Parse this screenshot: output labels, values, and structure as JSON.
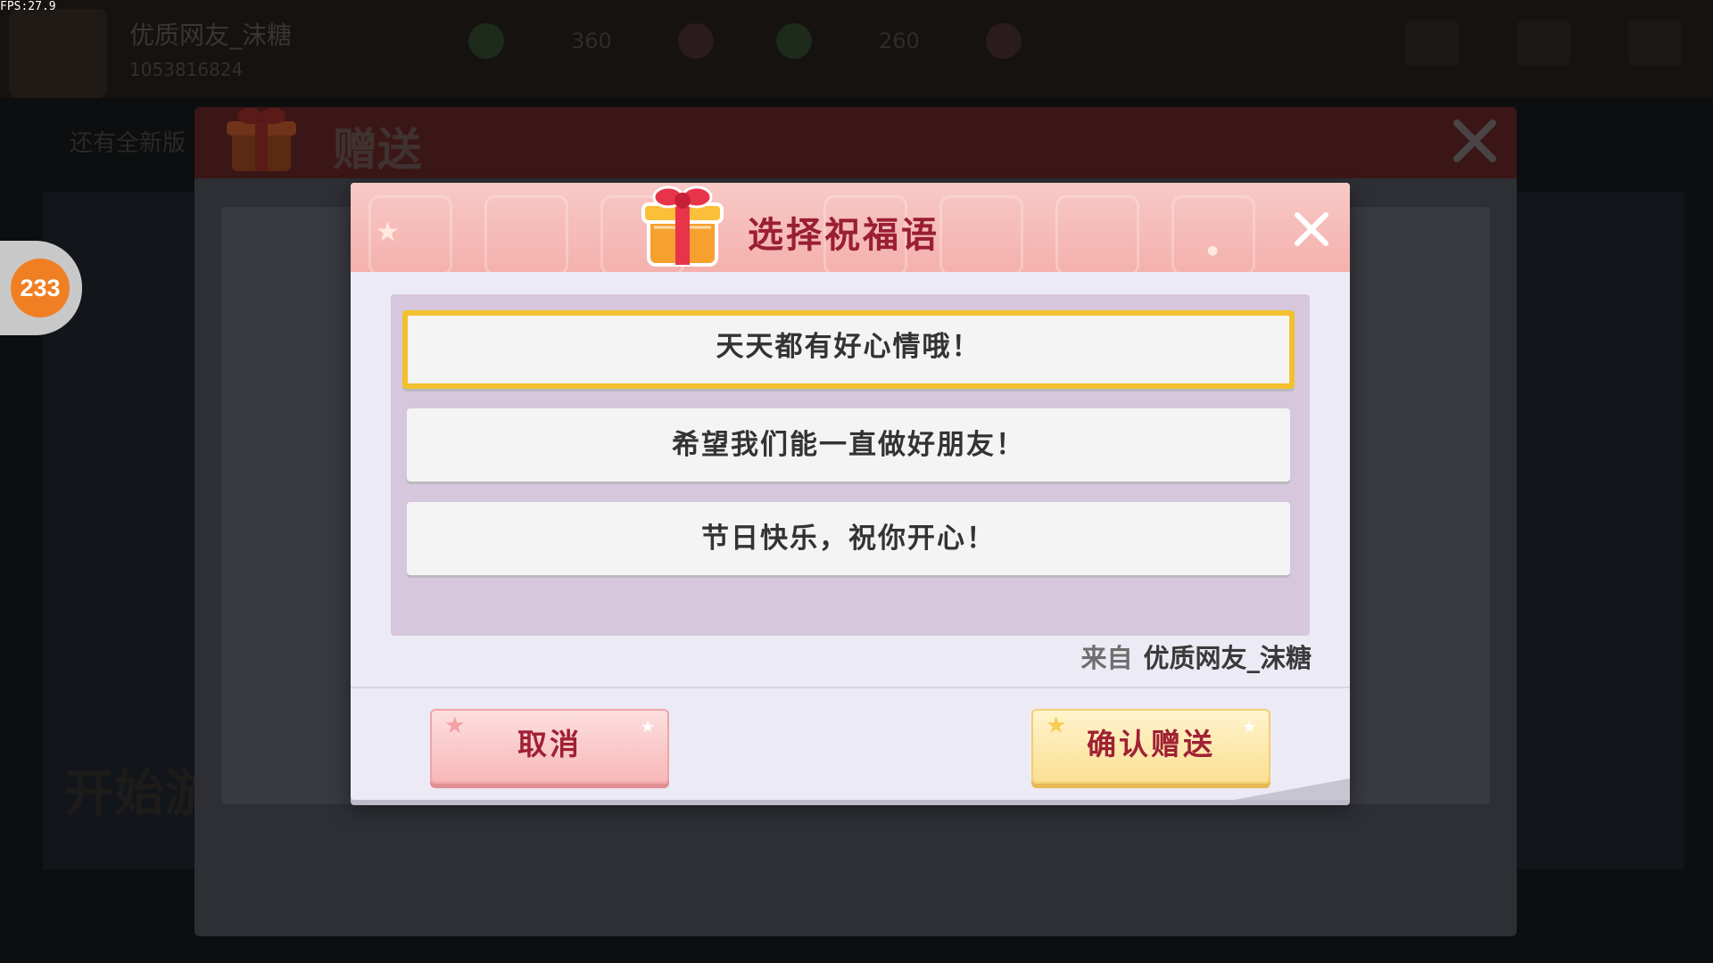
{
  "fps": "FPS:27.9",
  "background": {
    "player_name": "优质网友_沫糖",
    "player_id": "1053816824",
    "resource_1_value": "360",
    "resource_2_value": "260",
    "notice": "还有全新版",
    "start_label": "开始游",
    "gift_panel_title": "赠送"
  },
  "badge": {
    "value": "233",
    "color": "#f07f24"
  },
  "dialog": {
    "title": "选择祝福语",
    "options": [
      {
        "text": "天天都有好心情哦！",
        "selected": true
      },
      {
        "text": "希望我们能一直做好朋友！",
        "selected": false
      },
      {
        "text": "节日快乐，祝你开心！",
        "selected": false
      }
    ],
    "from_label": "来自",
    "from_name": "优质网友_沫糖",
    "cancel_label": "取消",
    "confirm_label": "确认赠送",
    "colors": {
      "title": "#9a1e34",
      "selected_border": "#f2c12e",
      "options_bg": "#d6c7dc",
      "cancel_bg": "#f7b6b6",
      "confirm_bg": "#fbdf91"
    }
  },
  "icons": {
    "dialog_gift": "gift-box-icon",
    "dialog_close": "close-icon",
    "panel_close": "close-icon",
    "panel_gift": "gift-box-icon"
  }
}
